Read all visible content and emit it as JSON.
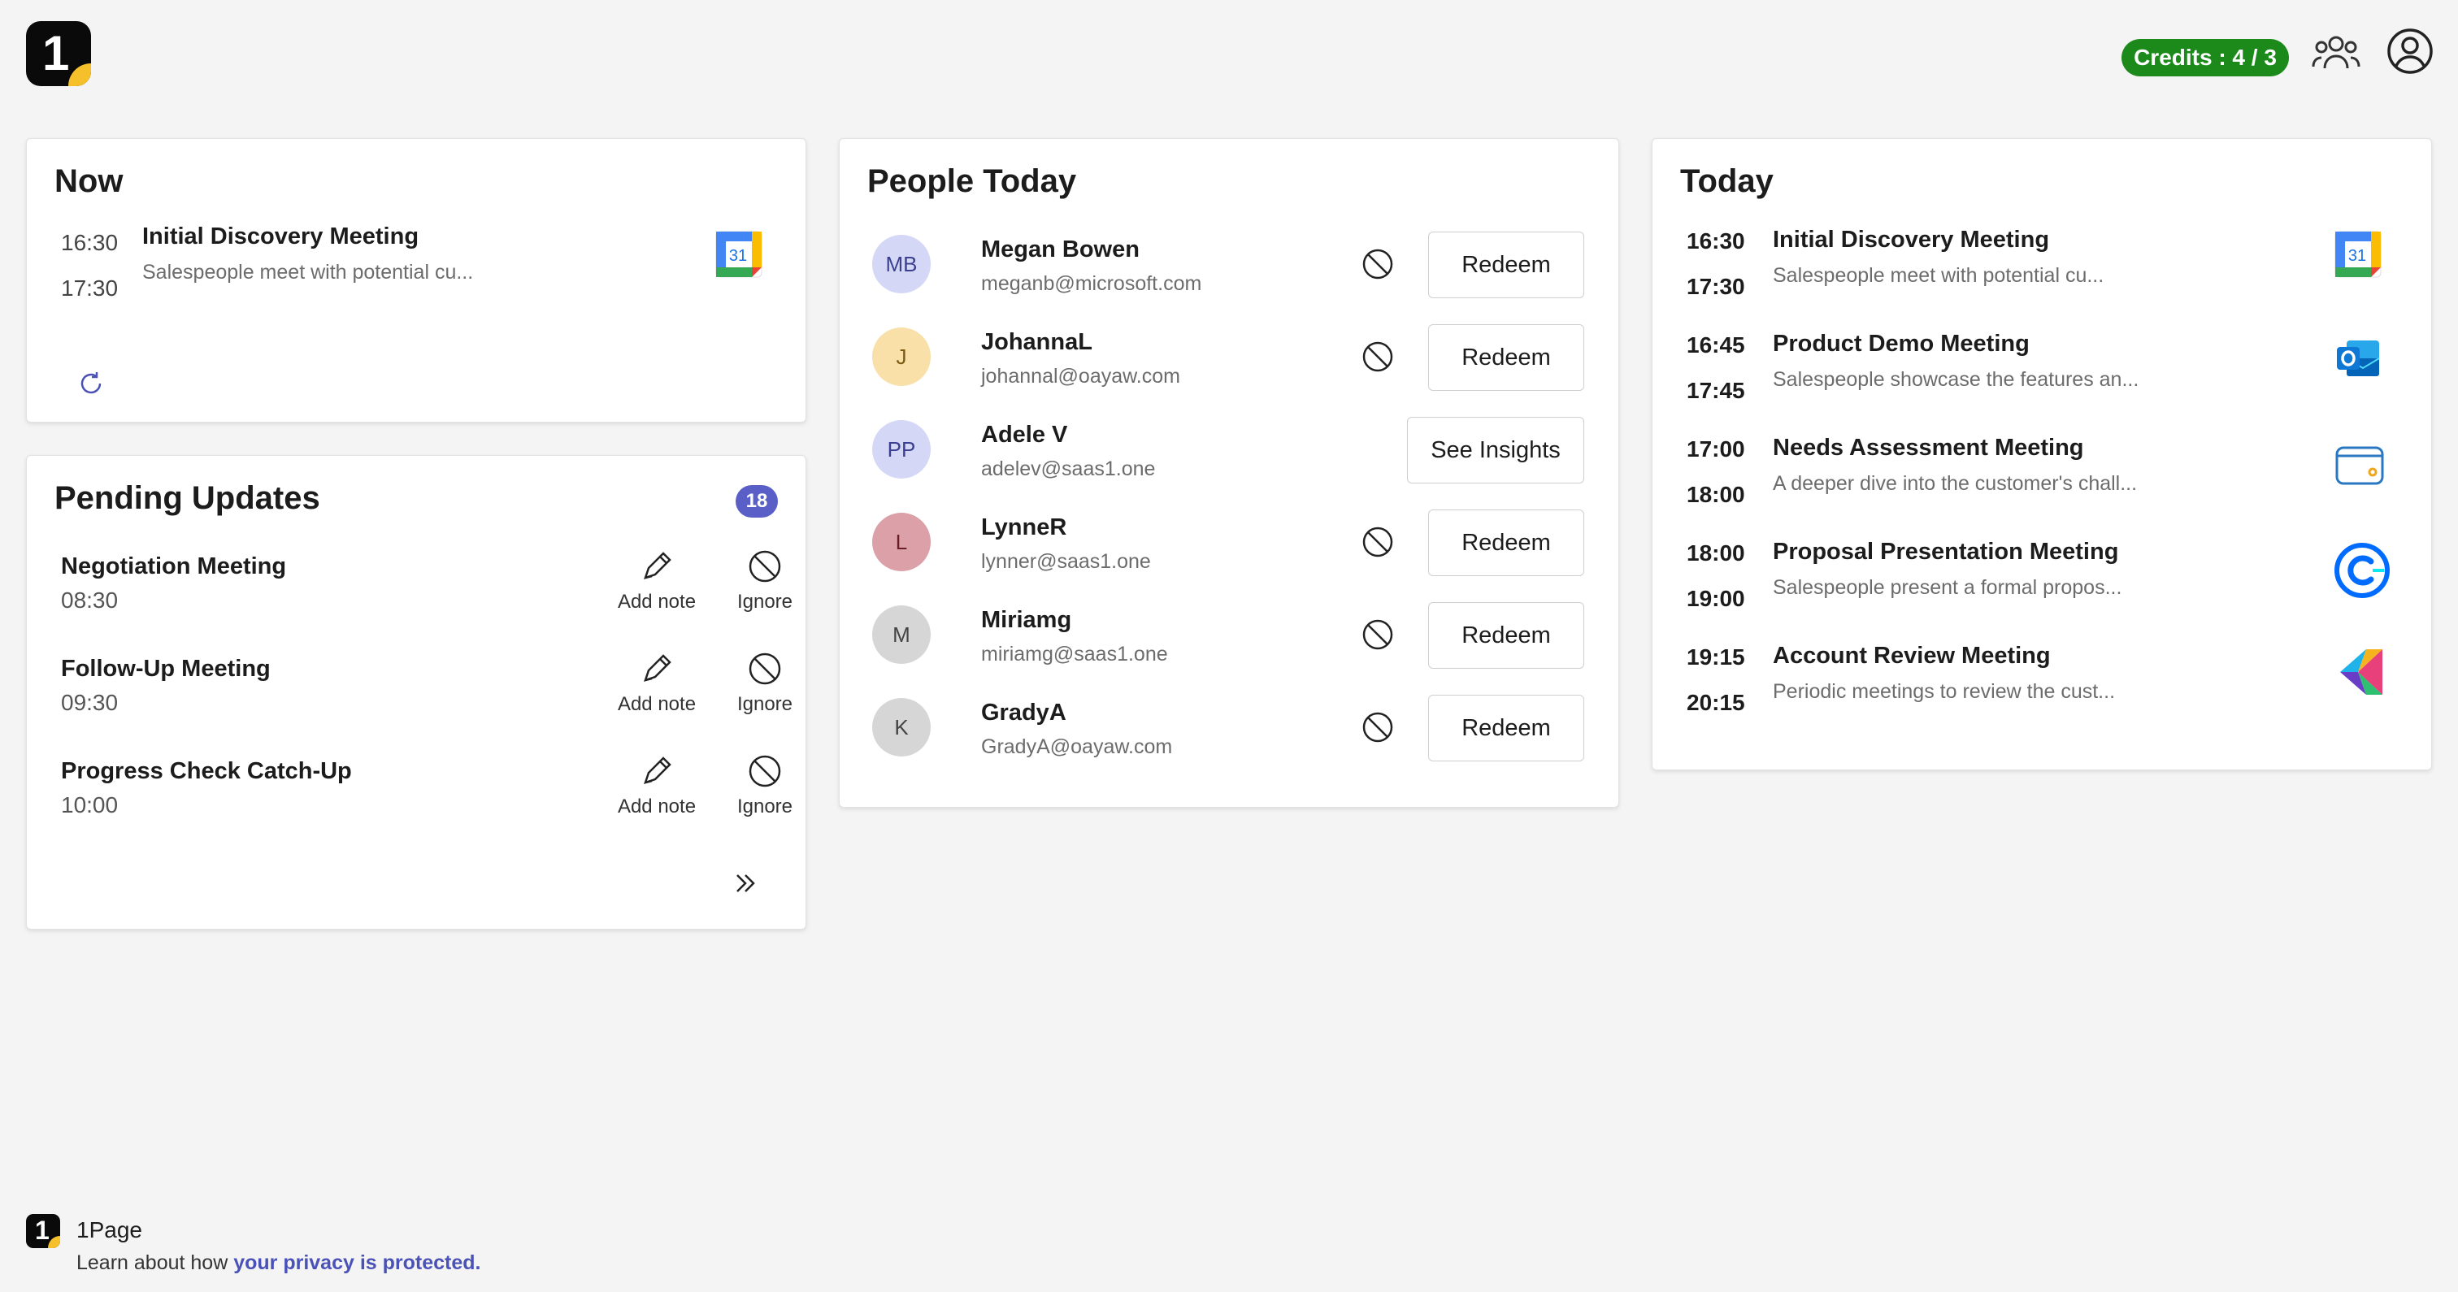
{
  "header": {
    "logo_text": "1",
    "credits_label": "Credits : 4 / 3",
    "icons": [
      "team-icon",
      "user-account-icon"
    ]
  },
  "now": {
    "title": "Now",
    "start": "16:30",
    "end": "17:30",
    "meeting_title": "Initial Discovery Meeting",
    "meeting_desc": "Salespeople meet with potential cu...",
    "icon": "google-calendar-icon",
    "calendar_day": "31"
  },
  "pending": {
    "title": "Pending Updates",
    "count": "18",
    "add_note_label": "Add note",
    "ignore_label": "Ignore",
    "items": [
      {
        "title": "Negotiation Meeting",
        "time": "08:30"
      },
      {
        "title": "Follow-Up Meeting",
        "time": "09:30"
      },
      {
        "title": "Progress Check Catch-Up",
        "time": "10:00"
      }
    ]
  },
  "people": {
    "title": "People Today",
    "items": [
      {
        "initials": "MB",
        "name": "Megan Bowen",
        "email": "meganb@microsoft.com",
        "action": "Redeem",
        "avatar_bg": "#d4d8f6",
        "avatar_fg": "#3a3f8f"
      },
      {
        "initials": "J",
        "name": "JohannaL",
        "email": "johannal@oayaw.com",
        "action": "Redeem",
        "avatar_bg": "#f8e0a8",
        "avatar_fg": "#7a5a10"
      },
      {
        "initials": "PP",
        "name": "Adele V",
        "email": "adelev@saas1.one",
        "action": "See Insights",
        "avatar_bg": "#d4d8f6",
        "avatar_fg": "#3a3f8f"
      },
      {
        "initials": "L",
        "name": "LynneR",
        "email": "lynner@saas1.one",
        "action": "Redeem",
        "avatar_bg": "#dba0a8",
        "avatar_fg": "#6a1d26"
      },
      {
        "initials": "M",
        "name": "Miriamg",
        "email": "miriamg@saas1.one",
        "action": "Redeem",
        "avatar_bg": "#d6d6d6",
        "avatar_fg": "#444444"
      },
      {
        "initials": "K",
        "name": "GradyA",
        "email": "GradyA@oayaw.com",
        "action": "Redeem",
        "avatar_bg": "#d6d6d6",
        "avatar_fg": "#444444"
      }
    ]
  },
  "today": {
    "title": "Today",
    "events": [
      {
        "start": "16:30",
        "end": "17:30",
        "title": "Initial Discovery Meeting",
        "desc": "Salespeople meet with potential cu...",
        "icon": "google-calendar-icon"
      },
      {
        "start": "16:45",
        "end": "17:45",
        "title": "Product Demo Meeting",
        "desc": "Salespeople showcase the features an...",
        "icon": "outlook-icon"
      },
      {
        "start": "17:00",
        "end": "18:00",
        "title": "Needs Assessment Meeting",
        "desc": "A deeper dive into the customer's chall...",
        "icon": "wallet-icon"
      },
      {
        "start": "18:00",
        "end": "19:00",
        "title": "Proposal Presentation Meeting",
        "desc": "Salespeople present a formal propos...",
        "icon": "calendly-icon"
      },
      {
        "start": "19:15",
        "end": "20:15",
        "title": "Account Review Meeting",
        "desc": "Periodic meetings to review the cust...",
        "icon": "kotlin-style-app-icon"
      }
    ]
  },
  "footer": {
    "brand": "1Page",
    "privacy_prefix": "Learn about how ",
    "privacy_link": "your privacy is protected."
  },
  "colors": {
    "credits_bg": "#1b8a1b",
    "badge_bg": "#5a5fc8",
    "link": "#4a52b8",
    "logo_accent": "#f5c02a"
  }
}
